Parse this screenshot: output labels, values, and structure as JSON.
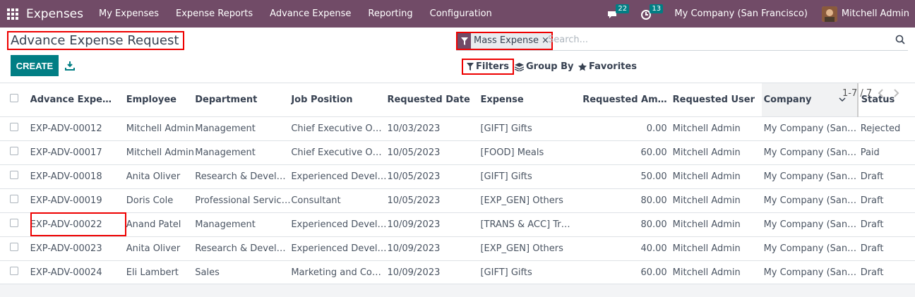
{
  "topbar": {
    "app_title": "Expenses",
    "menus": [
      "My Expenses",
      "Expense Reports",
      "Advance Expense",
      "Reporting",
      "Configuration"
    ],
    "messages_count": "22",
    "activities_count": "13",
    "company": "My Company (San Francisco)",
    "user": "Mitchell Admin"
  },
  "control": {
    "title": "Advance Expense Request",
    "create_label": "CREATE",
    "facet_label": "Mass Expense",
    "facet_remove": "×",
    "search_placeholder": "Search...",
    "filters_label": "Filters",
    "groupby_label": "Group By",
    "favorites_label": "Favorites",
    "pager": "1-7 / 7"
  },
  "table": {
    "headers": [
      "Advance Expe…",
      "Employee",
      "Department",
      "Job Position",
      "Requested Date",
      "Expense",
      "Requested Am…",
      "Requested User",
      "Company",
      "Status"
    ],
    "rows": [
      [
        "EXP-ADV-00012",
        "Mitchell Admin",
        "Management",
        "Chief Executive Off…",
        "10/03/2023",
        "[GIFT] Gifts",
        "0.00",
        "Mitchell Admin",
        "My Company (San F…",
        "Rejected"
      ],
      [
        "EXP-ADV-00017",
        "Mitchell Admin",
        "Management",
        "Chief Executive Off…",
        "10/05/2023",
        "[FOOD] Meals",
        "60.00",
        "Mitchell Admin",
        "My Company (San F…",
        "Paid"
      ],
      [
        "EXP-ADV-00018",
        "Anita Oliver",
        "Research & Develo…",
        "Experienced Devel…",
        "10/05/2023",
        "[GIFT] Gifts",
        "50.00",
        "Mitchell Admin",
        "My Company (San F…",
        "Draft"
      ],
      [
        "EXP-ADV-00019",
        "Doris Cole",
        "Professional Services",
        "Consultant",
        "10/05/2023",
        "[EXP_GEN] Others",
        "80.00",
        "Mitchell Admin",
        "My Company (San F…",
        "Draft"
      ],
      [
        "EXP-ADV-00022",
        "Anand Patel",
        "Management",
        "Experienced Devel…",
        "10/09/2023",
        "[TRANS & ACC] Tra…",
        "80.00",
        "Mitchell Admin",
        "My Company (San F…",
        "Draft"
      ],
      [
        "EXP-ADV-00023",
        "Anita Oliver",
        "Research & Develo…",
        "Experienced Devel…",
        "10/09/2023",
        "[EXP_GEN] Others",
        "40.00",
        "Mitchell Admin",
        "My Company (San F…",
        "Draft"
      ],
      [
        "EXP-ADV-00024",
        "Eli Lambert",
        "Sales",
        "Marketing and Co…",
        "10/09/2023",
        "[GIFT] Gifts",
        "60.00",
        "Mitchell Admin",
        "My Company (San F…",
        "Draft"
      ]
    ]
  },
  "colors": {
    "brand": "#714B67",
    "accent": "#017E84",
    "highlight": "#e00000"
  }
}
